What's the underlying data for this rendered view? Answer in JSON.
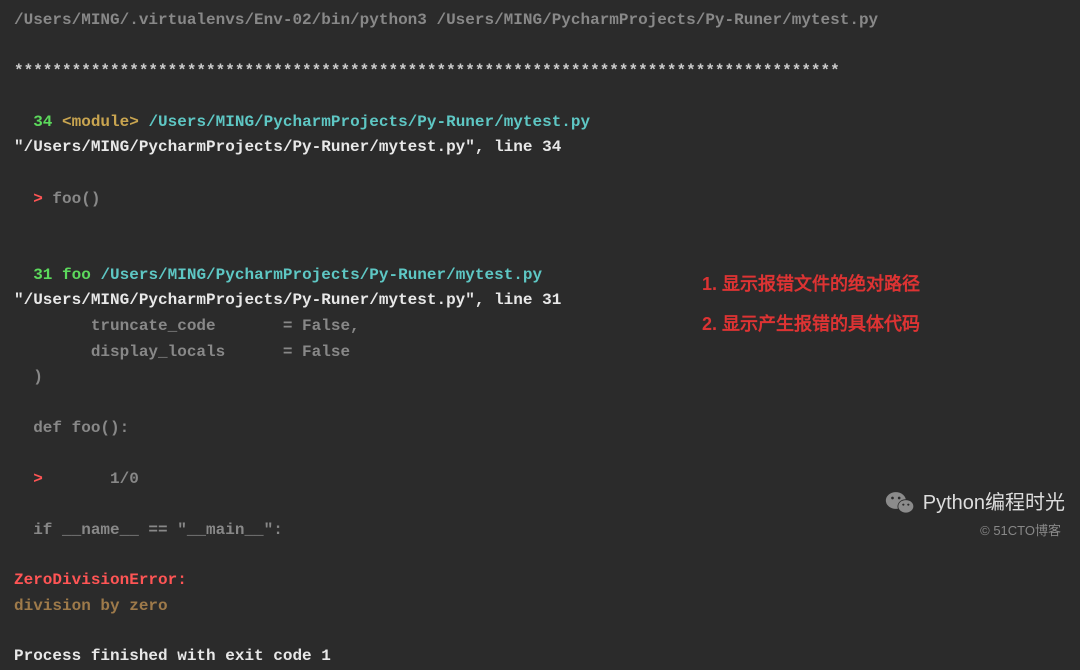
{
  "command_line": "/Users/MING/.virtualenvs/Env-02/bin/python3 /Users/MING/PycharmProjects/Py-Runer/mytest.py",
  "separator": "**************************************************************************************",
  "frame1": {
    "lineno": "34",
    "func": "<module>",
    "path": "/Users/MING/PycharmProjects/Py-Runer/mytest.py",
    "file_line": "\"/Users/MING/PycharmProjects/Py-Runer/mytest.py\", line 34",
    "marker": ">",
    "code": " foo()"
  },
  "frame2": {
    "lineno": "31",
    "func": "foo",
    "path": "/Users/MING/PycharmProjects/Py-Runer/mytest.py",
    "file_line": "\"/Users/MING/PycharmProjects/Py-Runer/mytest.py\", line 31",
    "context1": "        truncate_code       = False,",
    "context2": "        display_locals      = False",
    "context3": "  )",
    "context4": "  def foo():",
    "marker": ">",
    "code": "       1/0",
    "context5": "  if __name__ == \"__main__\":"
  },
  "error": {
    "type": "ZeroDivisionError:",
    "msg": "division by zero"
  },
  "exit_msg": "Process finished with exit code 1",
  "annotations": {
    "line1": "1. 显示报错文件的绝对路径",
    "line2": "2. 显示产生报错的具体代码"
  },
  "watermark": {
    "main": "Python编程时光",
    "sub": "© 51CTO博客"
  }
}
